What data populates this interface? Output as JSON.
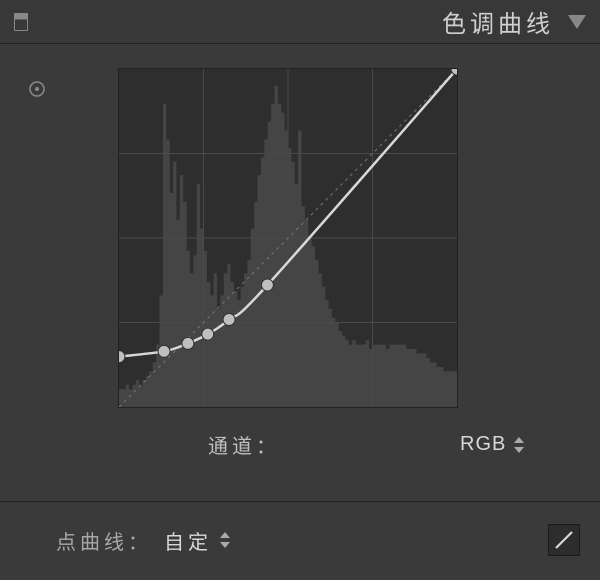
{
  "header": {
    "title": "色调曲线"
  },
  "channel": {
    "label": "通道：",
    "value": "RGB"
  },
  "point_curve": {
    "label": "点曲线：",
    "value": "自定"
  },
  "colors": {
    "bg": "#3a3a3a",
    "graph_bg": "#2e2e2e",
    "grid": "#4a4a4a",
    "curve": "#d8d8d8",
    "text": "#bfbfbf"
  },
  "chart_data": {
    "type": "line",
    "title": "色调曲线",
    "xlabel": "",
    "ylabel": "",
    "xlim": [
      0,
      255
    ],
    "ylim": [
      0,
      255
    ],
    "control_points": [
      {
        "x": 0,
        "y": 38
      },
      {
        "x": 34,
        "y": 42
      },
      {
        "x": 52,
        "y": 48
      },
      {
        "x": 67,
        "y": 55
      },
      {
        "x": 83,
        "y": 66
      },
      {
        "x": 112,
        "y": 92
      },
      {
        "x": 255,
        "y": 255
      }
    ],
    "histogram_bins": [
      4,
      4,
      5,
      4,
      5,
      6,
      5,
      6,
      7,
      8,
      10,
      14,
      25,
      68,
      60,
      48,
      55,
      42,
      52,
      46,
      35,
      30,
      34,
      50,
      40,
      35,
      28,
      25,
      30,
      22,
      25,
      30,
      32,
      28,
      26,
      24,
      27,
      30,
      33,
      40,
      46,
      52,
      56,
      60,
      64,
      68,
      72,
      68,
      66,
      62,
      58,
      55,
      50,
      62,
      45,
      42,
      38,
      36,
      33,
      30,
      27,
      24,
      22,
      20,
      19,
      17,
      16,
      15,
      14,
      15,
      14,
      14,
      14,
      15,
      13,
      14,
      14,
      14,
      14,
      13,
      14,
      14,
      14,
      14,
      14,
      13,
      13,
      13,
      12,
      12,
      12,
      11,
      10,
      10,
      9,
      9,
      8,
      8,
      8,
      8
    ]
  }
}
